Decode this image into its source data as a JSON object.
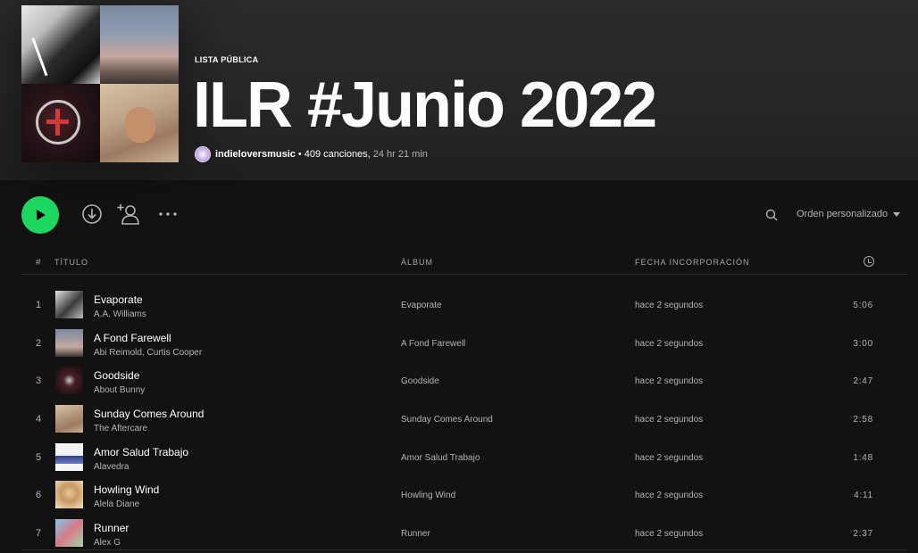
{
  "playlist": {
    "kicker": "LISTA PÚBLICA",
    "title": "ILR #Junio 2022",
    "owner": "indieloversmusic",
    "separator": "•",
    "song_count": "409 canciones,",
    "duration": "24 hr 21 min"
  },
  "controls": {
    "sort_label": "Orden personalizado",
    "icons": [
      "play-icon",
      "download-icon",
      "add-user-icon",
      "more-icon",
      "search-icon",
      "chevron-down-icon"
    ],
    "accent": "#1ed760"
  },
  "table": {
    "headers": {
      "num": "#",
      "title": "TÍTULO",
      "album": "ÁLBUM",
      "date": "FECHA INCORPORACIÓN"
    },
    "rows": [
      {
        "num": "1",
        "name": "Evaporate",
        "artist": "A.A. Williams",
        "album": "Evaporate",
        "date": "hace 2 segundos",
        "duration": "5:06"
      },
      {
        "num": "2",
        "name": "A Fond Farewell",
        "artist": "Abi Reimold, Curtis Cooper",
        "album": "A Fond Farewell",
        "date": "hace 2 segundos",
        "duration": "3:00"
      },
      {
        "num": "3",
        "name": "Goodside",
        "artist": "About Bunny",
        "album": "Goodside",
        "date": "hace 2 segundos",
        "duration": "2:47"
      },
      {
        "num": "4",
        "name": "Sunday Comes Around",
        "artist": "The Aftercare",
        "album": "Sunday Comes Around",
        "date": "hace 2 segundos",
        "duration": "2:58"
      },
      {
        "num": "5",
        "name": "Amor Salud Trabajo",
        "artist": "Alavedra",
        "album": "Amor Salud Trabajo",
        "date": "hace 2 segundos",
        "duration": "1:48"
      },
      {
        "num": "6",
        "name": "Howling Wind",
        "artist": "Alela Diane",
        "album": "Howling Wind",
        "date": "hace 2 segundos",
        "duration": "4:11"
      },
      {
        "num": "7",
        "name": "Runner",
        "artist": "Alex G",
        "album": "Runner",
        "date": "hace 2 segundos",
        "duration": "2:37"
      }
    ]
  }
}
